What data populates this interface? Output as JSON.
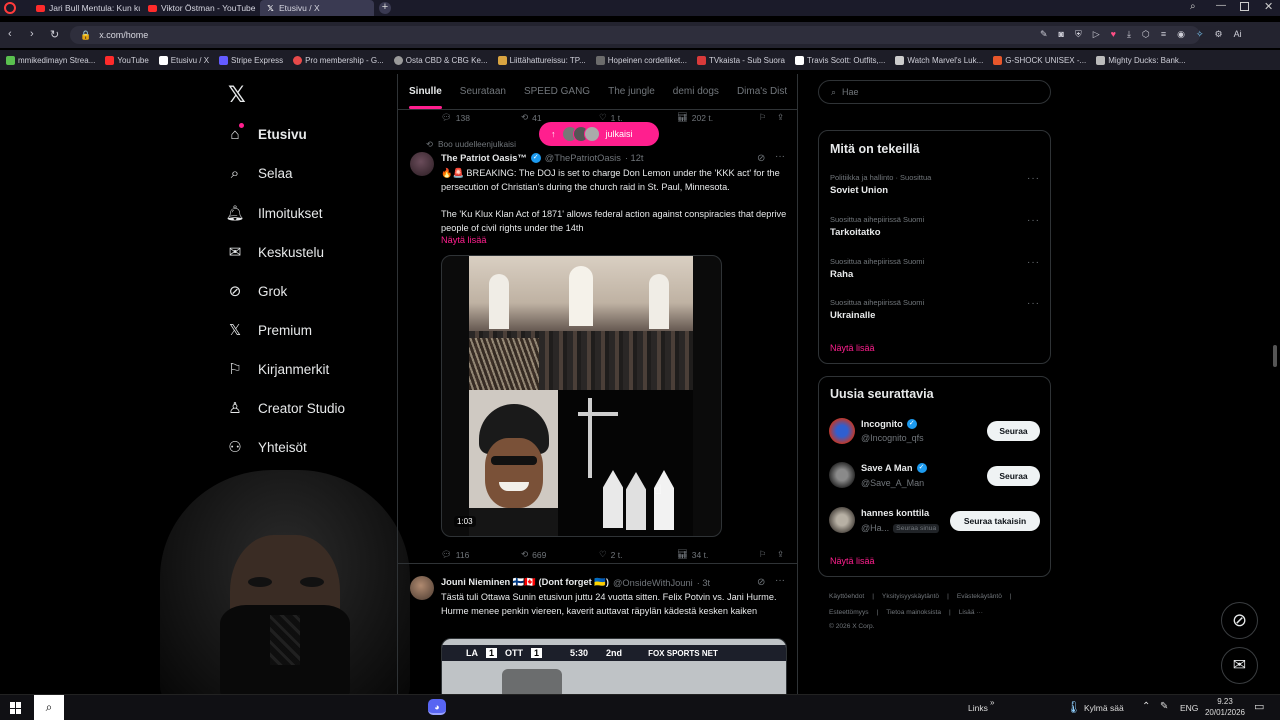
{
  "browser": {
    "tabs": [
      {
        "label": "Jari Bull Mentula: Kun ku...",
        "icon": "youtube"
      },
      {
        "label": "Viktor Östman - YouTube",
        "icon": "youtube"
      },
      {
        "label": "Etusivu / X",
        "icon": "x"
      }
    ],
    "url": "x.com/home",
    "bookmarks": [
      {
        "label": "mmikedimayn Strea...",
        "color": "#5ac04f"
      },
      {
        "label": "YouTube",
        "color": "#ff2b2b"
      },
      {
        "label": "Etusivu / X",
        "color": "#ffffff"
      },
      {
        "label": "Stripe Express",
        "color": "#635bff"
      },
      {
        "label": "Pro membership - G...",
        "color": "#e84a4a"
      },
      {
        "label": "Osta CBD & CBG Ke...",
        "color": "#9a9a9a"
      },
      {
        "label": "Liittähattureissu: TP...",
        "color": "#d9a441"
      },
      {
        "label": "Hopeinen cordelliket...",
        "color": "#6b6b6b"
      },
      {
        "label": "TVkaista - Sub Suora",
        "color": "#d93a3a"
      },
      {
        "label": "Travis Scott: Outfits,...",
        "color": "#ffffff"
      },
      {
        "label": "Watch Marvel's Luk...",
        "color": "#cccccc"
      },
      {
        "label": "G-SHOCK UNISEX -...",
        "color": "#e8572b"
      },
      {
        "label": "Mighty Ducks: Bank...",
        "color": "#bbbbbb"
      }
    ]
  },
  "sidebar": {
    "items": [
      {
        "label": "Etusivu",
        "icon": "home-icon"
      },
      {
        "label": "Selaa",
        "icon": "search-icon"
      },
      {
        "label": "Ilmoitukset",
        "icon": "bell-icon"
      },
      {
        "label": "Keskustelu",
        "icon": "mail-icon"
      },
      {
        "label": "Grok",
        "icon": "grok-icon"
      },
      {
        "label": "Premium",
        "icon": "x-icon"
      },
      {
        "label": "Kirjanmerkit",
        "icon": "bookmark-icon"
      },
      {
        "label": "Creator Studio",
        "icon": "creator-icon"
      },
      {
        "label": "Yhteisöt",
        "icon": "communities-icon"
      },
      {
        "label": "",
        "icon": "profile-icon"
      }
    ]
  },
  "timeline": {
    "tabs": [
      "Sinulle",
      "Seurataan",
      "SPEED GANG",
      "The jungle",
      "demi dogs",
      "Dima's Dist"
    ],
    "prev_stats": {
      "replies": "138",
      "reposts": "41",
      "likes": "1 t.",
      "views": "202 t."
    },
    "new_posts_pill": "julkaisi",
    "tweet1": {
      "repost_line": "Boo uudelleenjulkaisi",
      "name": "The Patriot Oasis™",
      "handle": "@ThePatriotOasis",
      "time": "· 12t",
      "text1": "🔥🚨 BREAKING: The DOJ is set to charge Don Lemon under the 'KKK act' for the persecution of Christian's during the church raid in St. Paul, Minnesota.",
      "text2": "The 'Ku Klux Klan Act of 1871' allows federal action against conspiracies that deprive people of civil rights under the 14th",
      "show_more": "Näytä lisää",
      "video_time": "1:03",
      "stats": {
        "replies": "116",
        "reposts": "669",
        "likes": "2 t.",
        "views": "34 t."
      }
    },
    "tweet2": {
      "name": "Jouni Nieminen 🇫🇮🇨🇦 (Dont forget 🇺🇦)",
      "handle": "@OnsideWithJouni",
      "time": "· 3t",
      "text": "Tästä tuli Ottawa Sunin etusivun juttu 24 vuotta sitten. Felix Potvin vs. Jani Hurme. Hurme menee penkin viereen, kaverit auttavat räpylän kädestä kesken kaiken",
      "score_home": "LA",
      "score_home_val": "1",
      "score_away": "OTT",
      "score_away_val": "1",
      "clock": "5:30",
      "period": "2nd",
      "network": "FOX SPORTS NET"
    }
  },
  "right": {
    "search_placeholder": "Hae",
    "trends_title": "Mitä on tekeillä",
    "trends": [
      {
        "sub": "Politiikka ja hallinto · Suosittua",
        "main": "Soviet Union"
      },
      {
        "sub": "Suosittua aihepiirissä Suomi",
        "main": "Tarkoitatko"
      },
      {
        "sub": "Suosittua aihepiirissä Suomi",
        "main": "Raha"
      },
      {
        "sub": "Suosittua aihepiirissä Suomi",
        "main": "Ukrainalle"
      }
    ],
    "trends_more": "Näytä lisää",
    "follow_title": "Uusia seurattavia",
    "follows": [
      {
        "name": "Incognito",
        "handle": "@Incognito_qfs",
        "button": "Seuraa",
        "verified": true
      },
      {
        "name": "Save A Man",
        "handle": "@Save_A_Man",
        "button": "Seuraa",
        "verified": true
      },
      {
        "name": "hannes konttila",
        "handle": "@Ha...",
        "badge": "Seuraa sinua",
        "button": "Seuraa takaisin",
        "verified": false
      }
    ],
    "follow_more": "Näytä lisää",
    "footer_line1": [
      "Käyttöehdot",
      "|",
      "Yksityisyyskäytäntö",
      "|",
      "Evästekäytäntö",
      "|"
    ],
    "footer_line2": [
      "Esteettömyys",
      "|",
      "Tietoa mainoksista",
      "|",
      "Lisää ···"
    ],
    "footer_copy": "© 2026 X Corp."
  },
  "taskbar": {
    "links": "Links",
    "weather": "Kylmä sää",
    "lang": "ENG",
    "time": "9.23",
    "date": "20/01/2026"
  }
}
